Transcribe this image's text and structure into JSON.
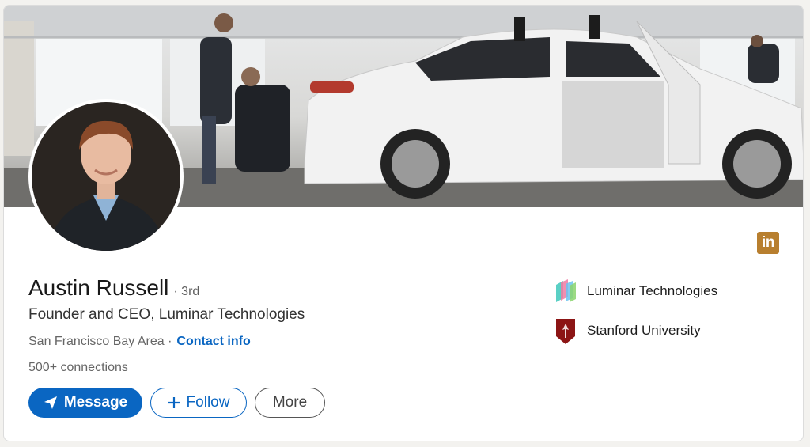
{
  "profile": {
    "name": "Austin Russell",
    "degree": "· 3rd",
    "headline": "Founder and CEO, Luminar Technologies",
    "location": "San Francisco Bay Area ·",
    "contact_label": "Contact info",
    "connections": "500+ connections"
  },
  "actions": {
    "message_label": "Message",
    "follow_label": "Follow",
    "more_label": "More"
  },
  "organizations": [
    {
      "name": "Luminar Technologies",
      "icon": "luminar-logo-icon"
    },
    {
      "name": "Stanford University",
      "icon": "stanford-logo-icon"
    }
  ],
  "badge": {
    "text": "in",
    "icon": "linkedin-icon",
    "color": "#b87f2f"
  },
  "colors": {
    "primary": "#0a66c2",
    "card": "#ffffff",
    "background": "#f3f2ef"
  }
}
